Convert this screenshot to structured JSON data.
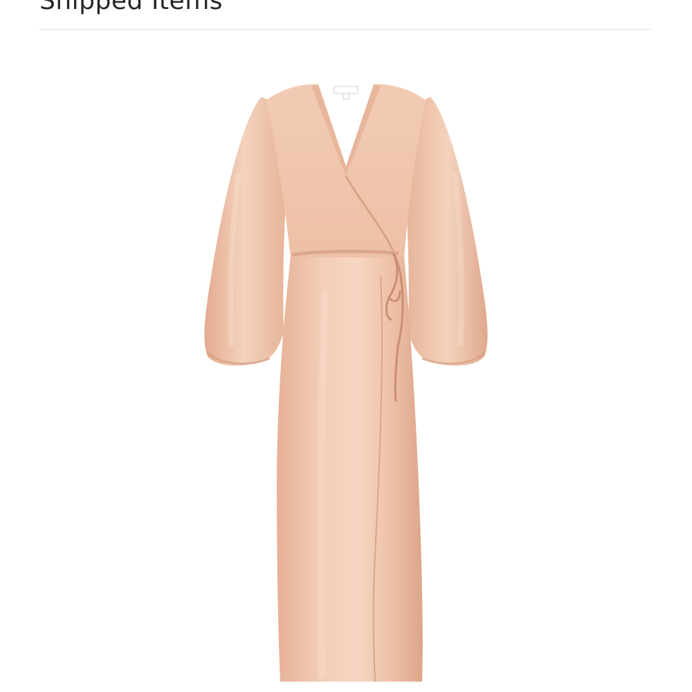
{
  "section": {
    "title": "Shipped Items"
  },
  "product": {
    "image_icon": "wrap-dress-image",
    "colors": {
      "fabric": "#efc3aa",
      "fabric_light": "#f7d9c7",
      "fabric_shadow": "#d9a58a",
      "fabric_deep": "#c99479"
    }
  },
  "colors": {
    "background": "#ffffff",
    "title_text": "#262626",
    "divider": "#e4e4e4"
  }
}
